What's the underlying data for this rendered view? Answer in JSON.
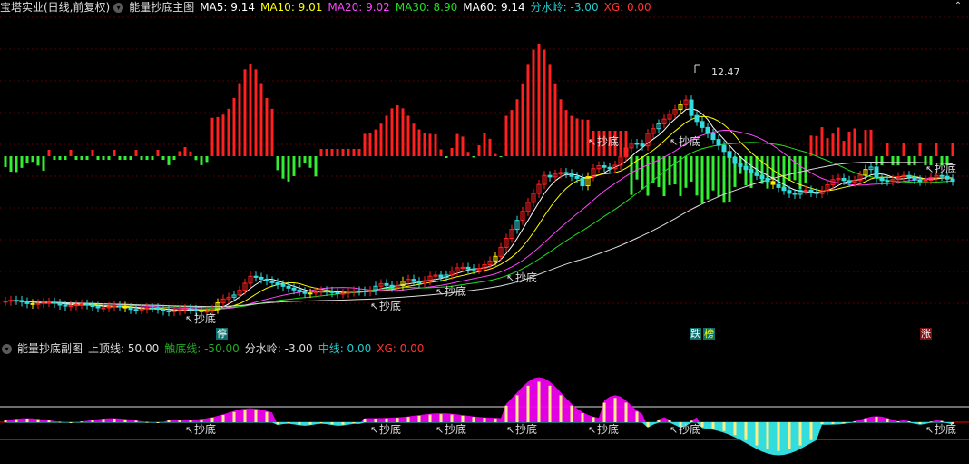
{
  "main": {
    "stock_name": "宝塔实业(日线,前复权)",
    "indicator": "能量抄底主图",
    "ma": [
      {
        "label": "MA5: 9.14",
        "color": "#ffffff"
      },
      {
        "label": "MA10: 9.01",
        "color": "#ffff00"
      },
      {
        "label": "MA20: 9.02",
        "color": "#ff44ff"
      },
      {
        "label": "MA30: 8.90",
        "color": "#22dd22"
      },
      {
        "label": "MA60: 9.14",
        "color": "#ffffff"
      },
      {
        "label": "分水岭: -3.00",
        "color": "#22cccc"
      },
      {
        "label": "XG: 0.00",
        "color": "#ff3333"
      }
    ],
    "price_high": "12.47",
    "badge_stop": "停",
    "badge_fall": "跌",
    "badge_list": "榜",
    "badge_rise": "涨",
    "marker_text": "抄底"
  },
  "sub": {
    "title": "能量抄底副图",
    "items": [
      {
        "label": "上顶线: 50.00",
        "color": "#dddddd"
      },
      {
        "label": "触底线: -50.00",
        "color": "#22aa22"
      },
      {
        "label": "分水岭: -3.00",
        "color": "#dddddd"
      },
      {
        "label": "中线: 0.00",
        "color": "#22cccc"
      },
      {
        "label": "XG: 0.00",
        "color": "#ff3333"
      }
    ]
  },
  "colors": {
    "up": "#ff2020",
    "down": "#33ee33",
    "cyan": "#33dddd",
    "yellow": "#ffee00",
    "magenta": "#ee00ee"
  }
}
